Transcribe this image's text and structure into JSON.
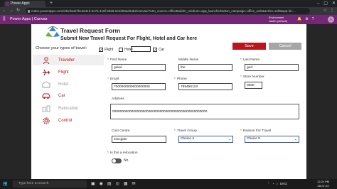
{
  "browser": {
    "tab_title": "Power Apps",
    "new_tab": "+",
    "url": "make.powerapps.com/e/Default-fbca541b-0c75-415f-9658-0e4590ad2ab2/canvas/?utm_source=officeBuilder_medium=app_launcherbutton_campaign=office_web&action=edit&app-id=...",
    "window_controls": [
      "–",
      "▢",
      "✕"
    ],
    "nav_icons": [
      "back-icon",
      "forward-icon",
      "reload-icon"
    ],
    "nav_glyphs": [
      "←",
      "→",
      "↻"
    ]
  },
  "powerapps_header": {
    "title": "Power Apps | Canvas",
    "environment_label": "Environment",
    "environment_name": "Jaidev (default)",
    "avatar": "JK"
  },
  "form": {
    "title": "Travel Request Form",
    "subtitle": "Submit New Travel Request For Flight, Hotel and Car here",
    "choose_label": "Choose your types of travel:",
    "travel_types": [
      {
        "label": "Flight",
        "checked": true
      },
      {
        "label": "Hotel",
        "checked": false
      },
      {
        "label": "Car",
        "checked": true
      }
    ],
    "check_mark": "✓",
    "save_label": "Save",
    "cancel_label": "Cancel"
  },
  "sidebar": {
    "items": [
      {
        "label": "Traveller",
        "icon": "user-icon",
        "state": "active"
      },
      {
        "label": "Flight",
        "icon": "airplane-icon",
        "state": "enabled"
      },
      {
        "label": "Hotel",
        "icon": "hotel-icon",
        "state": "disabled"
      },
      {
        "label": "Car",
        "icon": "car-icon",
        "state": "enabled"
      },
      {
        "label": "Relocation",
        "icon": "relocation-icon",
        "state": "disabled"
      },
      {
        "label": "Control",
        "icon": "gear-icon",
        "state": "enabled"
      }
    ]
  },
  "fields": {
    "required_mark": "*",
    "first_name": {
      "label": "First Name",
      "value": "gokul"
    },
    "middle_name": {
      "label": "Middle Name",
      "value": "the"
    },
    "last_name": {
      "label": "Last Name",
      "value": "god"
    },
    "email": {
      "label": "Email",
      "value": "7000000000000000000"
    },
    "phone": {
      "label": "Phone",
      "value": "789456123"
    },
    "store_number": {
      "label": "Store Number",
      "value": "0000"
    },
    "address": {
      "label": "Address",
      "value": "00000000000000000000000000000000000000000000000000"
    },
    "cost_centre": {
      "label": "Cost Centre",
      "value": "zsncjpkn"
    },
    "travel_group": {
      "label": "Travel Group",
      "value": "Choice 4"
    },
    "reason": {
      "label": "Reason For Travel",
      "value": "Choice 5"
    },
    "relocation": {
      "label": "Is this a relocation",
      "value": "No"
    }
  },
  "taskbar": {
    "search_placeholder": "Type here to search",
    "tray_text": "ENG",
    "time": "12:24 PM",
    "date": "28-07-22"
  },
  "colors": {
    "accent_red": "#b8161e",
    "powerapps_purple": "#742774",
    "dropdown_border": "#3b5c9c"
  }
}
